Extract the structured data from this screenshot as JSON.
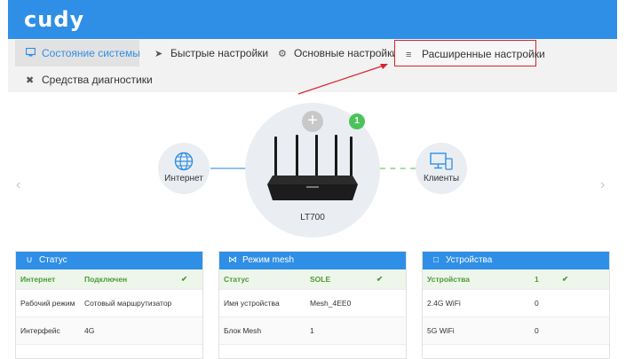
{
  "brand": {
    "logo": "cudy"
  },
  "nav": {
    "tabs": [
      {
        "label": "Состояние системы",
        "icon": "monitor-icon",
        "active": true
      },
      {
        "label": "Быстрые настройки",
        "icon": "rocket-icon"
      },
      {
        "label": "Основные настройки",
        "icon": "gear-icon"
      },
      {
        "label": "Расширенные настройки",
        "icon": "sliders-icon",
        "highlighted": true
      },
      {
        "label": "Средства диагностики",
        "icon": "tools-icon"
      }
    ]
  },
  "topology": {
    "internet_label": "Интернет",
    "clients_label": "Клиенты",
    "router_name": "LT700",
    "plus": "+",
    "badge_count": "1"
  },
  "cards": {
    "status": {
      "title": "Статус",
      "header": {
        "col1": "Интернет",
        "col2": "Подключен"
      },
      "rows": [
        {
          "label": "Рабочий режим",
          "value": "Сотовый маршрутизатор"
        },
        {
          "label": "Интерфейс",
          "value": "4G"
        }
      ]
    },
    "mesh": {
      "title": "Режим mesh",
      "header": {
        "col1": "Статус",
        "col2": "SOLE"
      },
      "rows": [
        {
          "label": "Имя устройства",
          "value": "Mesh_4EE0"
        },
        {
          "label": "Блок Mesh",
          "value": "1"
        }
      ]
    },
    "devices": {
      "title": "Устройства",
      "header": {
        "col1": "Устройства",
        "col2": "1"
      },
      "rows": [
        {
          "label": "2.4G WiFi",
          "value": "0"
        },
        {
          "label": "5G WiFi",
          "value": "0"
        }
      ]
    }
  },
  "colors": {
    "accent": "#2f8fe6",
    "ok": "#4b9a38",
    "highlight": "#d9232d",
    "badge": "#4cc35a"
  }
}
